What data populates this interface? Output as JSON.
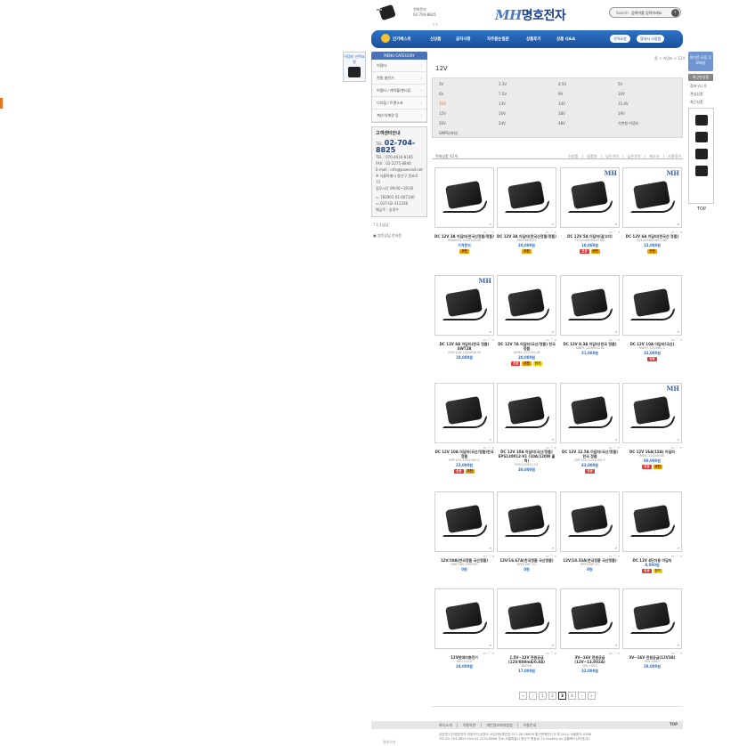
{
  "header": {
    "call_center_label": "전화문의",
    "call_center_phone": "02-704-8825",
    "cart_arrows": "‹ ›",
    "logo_mh": "MH",
    "logo_name": "명호전자",
    "search_label": "Search",
    "search_value": "검색어를 입력하세요",
    "search_button": "›"
  },
  "nav": {
    "items": [
      "인기베스트",
      "신상품",
      "공지사항",
      "자주묻는질문",
      "상품후기",
      "상품 Q&A"
    ],
    "buttons": [
      "견적요청",
      "명세서 사용법"
    ]
  },
  "left": {
    "menu_title": "MENU CATEGORY",
    "categories": [
      "어댑터",
      "전원 충전기",
      "어댑터 / 케이블/젠더류",
      "디지털 / 트랜스포",
      "계산기/계량 등"
    ],
    "cs_title": "고객센터안내",
    "cs_phone_label": "TEL.",
    "cs_phone": "02-704-8825",
    "cs_tel2": "TEL : 070-4616-8185",
    "cs_fax": "FAX : 02-2275-8846",
    "cs_email": "E-mail : info@powerall.net",
    "cs_addr": "※ 서울특별시 용산구 원효로 73",
    "cs_hours": "업무시간 09:00~19:00",
    "bank1": "782901-01-007140",
    "bank2": "027-02-311328",
    "bank_owner": "예금주 : 송명수",
    "link1": "1:1상담",
    "link2": "방문상담 안내문"
  },
  "side_banner": "어댑터 선택요령",
  "right_quick": {
    "box_label": "아이콘 모음 무료배송",
    "recent_label": "최근본상품",
    "wish": "장바구니",
    "wish_count": "0",
    "notice": "관심상품",
    "recent": "최근상품",
    "top": "TOP"
  },
  "breadcrumb": "홈 > 어댑터 > 12V",
  "page_title": "12V",
  "subcats": [
    [
      "3V",
      "3.3V",
      "4.5V",
      "5V"
    ],
    [
      "6V",
      "7.5V",
      "9V",
      "10V"
    ],
    [
      "12V",
      "13V",
      "14V",
      "15.4V"
    ],
    [
      "15V",
      "16V",
      "18V",
      "19V"
    ],
    [
      "20V",
      "24V",
      "48V",
      "가변형 어댑터"
    ],
    [
      "SMPS(파워)"
    ]
  ],
  "product_count": "전체상품 42개",
  "sort_options": [
    "신상품",
    "상품명",
    "낮은가격",
    "높은가격",
    "제조사",
    "사용후기"
  ],
  "products": [
    {
      "name": "DC 12V 3A 아답터(한국산정품/정품)",
      "code": "SMR045-1202500-W",
      "price": "가격문의",
      "badges": [
        "추천"
      ]
    },
    {
      "name": "DC 12V 3A 아답터(한국산정품/정품)",
      "code": "MS-Y36IP-VT",
      "price": "20,000원",
      "badges": [
        "추천"
      ]
    },
    {
      "name": "DC 12V 5A 아답터(갈고리)",
      "code": "TY1205000420 MS",
      "price": "18,000원",
      "badges": [
        "신상",
        "추천"
      ]
    },
    {
      "name": "DC 12V 6A 아답터(한국산 정품)",
      "code": "TY1205000(KC) MS",
      "price": "13,000원",
      "badges": [
        "추천"
      ]
    },
    {
      "name": "DC 12V 8A 아답터(한국 정품) SWT2B",
      "code": "SW2108-1200800-W",
      "price": "18,000원",
      "badges": []
    },
    {
      "name": "DC 12V 7A 아답터(국산/정품) 한국 정품",
      "code": "DPHS-120700-W",
      "price": "20,000원",
      "badges": [
        "신상",
        "추천",
        "인기"
      ]
    },
    {
      "name": "DC 12V 8.3A 아답터(한국 정품)",
      "code": "SWPF-1200000-W",
      "price": "31,000원",
      "badges": []
    },
    {
      "name": "DC 12V 10A 아답터(국산)",
      "code": "SW37-1200KC-1",
      "price": "32,000원",
      "badges": [
        "신상"
      ]
    },
    {
      "name": "DC 12V 10A 아답터(국산/정품)한국 정품",
      "code": "DPF120-1201000-F",
      "price": "23,000원",
      "badges": [
        "신상",
        "추천"
      ]
    },
    {
      "name": "DC 12V 10A 아답터(국산/정품) EPS120012-V1 (10A/120W 출력)",
      "code": "EPS120012-V1",
      "price": "30,000원",
      "badges": []
    },
    {
      "name": "DC 12V 12.5A 아답터(국산/정품) 한국 정품",
      "code": "DPF150-1201250-F",
      "price": "43,000원",
      "badges": [
        "신상"
      ]
    },
    {
      "name": "DC 12V 16A(15A) 아답터",
      "code": "MH1-1201600E",
      "price": "80,000원",
      "badges": [
        "신상",
        "추천"
      ]
    },
    {
      "name": "12V/10A(한국정품 국산정품)",
      "code": "SWF160-1000SG",
      "price": "0원",
      "badges": []
    },
    {
      "name": "12V/16.67A(한국정품 국산정품)",
      "code": "EPP200F-V1",
      "price": "0원",
      "badges": []
    },
    {
      "name": "12V/18.33A(한국정품 국산정품)",
      "code": "EPP220F-V1",
      "price": "0원",
      "badges": []
    },
    {
      "name": "DC 12V 4단자용 아답터",
      "code": "",
      "price": "8,000원",
      "badges": [
        "신상",
        "인기"
      ]
    },
    {
      "name": "12V밧데리충전기",
      "code": "MCI-1212",
      "price": "24,000원",
      "badges": []
    },
    {
      "name": "1.5V~12V 전원공급 (12V/800mA/0.8A)",
      "code": "800SS",
      "price": "17,000원",
      "badges": []
    },
    {
      "name": "3V~16V 전원공급 (12V~13.8V2A)",
      "code": "MH-1000",
      "price": "32,000원",
      "badges": []
    },
    {
      "name": "3V~16V 전원공급(12V3A)",
      "code": "MH-3000",
      "price": "28,000원",
      "badges": []
    }
  ],
  "pager": [
    "«",
    "‹",
    "1",
    "2",
    "3",
    "4",
    "›",
    "»"
  ],
  "pager_current": "3",
  "footer": {
    "links": "회사소개 | 이용약관 | 개인정보처리방침 | 이용안내",
    "top": "TOP",
    "info1": "상호명:(주)명호전자  대표이사:송명수  사업자등록번호:217-08-98858  통신판매업신고:제 2011-서울용산-0286",
    "info2": "TEL:02-704-8825  FAX:02-2275-8846  주소:서울특별시 용산구 원효로 73  Hosting by 심플렉스인터넷(주)",
    "logo": "명호전자"
  }
}
